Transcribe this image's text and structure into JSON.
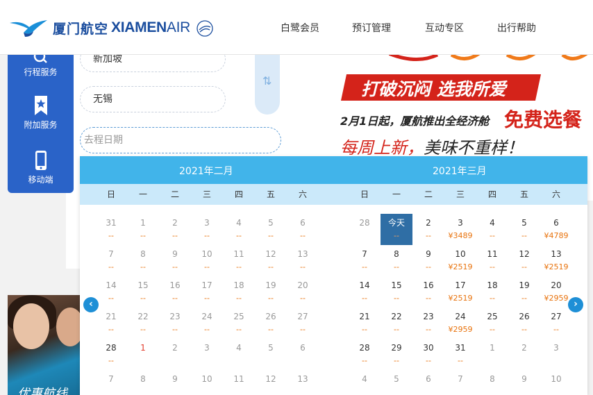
{
  "header": {
    "logo_zh": "厦门航空",
    "logo_en_bold": "XIAMEN",
    "logo_en_thin": "AIR",
    "nav": [
      {
        "label": "白鹭会员",
        "id": "member"
      },
      {
        "label": "预订管理",
        "id": "booking"
      },
      {
        "label": "互动专区",
        "id": "interactive"
      },
      {
        "label": "出行帮助",
        "id": "help"
      }
    ]
  },
  "sidebar": {
    "items": [
      {
        "label": "行程服务",
        "icon": "search-icon"
      },
      {
        "label": "附加服务",
        "icon": "bookmark-star-icon"
      },
      {
        "label": "移动端",
        "icon": "mobile-phone-icon"
      }
    ]
  },
  "booking": {
    "from_value": "新加坡",
    "to_value": "无锡",
    "date_placeholder": "去程日期"
  },
  "banner": {
    "slogan": "打破沉闷 选我所爱",
    "line2": "2月1日起，厦航推出全经济舱",
    "line2_highlight": "免费选餐",
    "line3_red": "每周上新，",
    "line3_dark": "美味不重样！"
  },
  "photo": {
    "caption": "优惠航线"
  },
  "colors": {
    "brand": "#1a4d9e",
    "calendar_header": "#41b4ea",
    "week_row": "#cbe9fa",
    "today": "#2f6ea5",
    "price": "#e8720c"
  },
  "calendar": {
    "weekdays": [
      "日",
      "一",
      "二",
      "三",
      "四",
      "五",
      "六"
    ],
    "months": [
      {
        "title": "2021年二月",
        "weeks": [
          [
            {
              "n": "31",
              "p": "--",
              "s": "dim"
            },
            {
              "n": "1",
              "p": "--",
              "s": "dim"
            },
            {
              "n": "2",
              "p": "--",
              "s": "dim"
            },
            {
              "n": "3",
              "p": "--",
              "s": "dim"
            },
            {
              "n": "4",
              "p": "--",
              "s": "dim"
            },
            {
              "n": "5",
              "p": "--",
              "s": "dim"
            },
            {
              "n": "6",
              "p": "--",
              "s": "dim"
            }
          ],
          [
            {
              "n": "7",
              "p": "--",
              "s": "dim"
            },
            {
              "n": "8",
              "p": "--",
              "s": "dim"
            },
            {
              "n": "9",
              "p": "--",
              "s": "dim"
            },
            {
              "n": "10",
              "p": "--",
              "s": "dim"
            },
            {
              "n": "11",
              "p": "--",
              "s": "dim"
            },
            {
              "n": "12",
              "p": "--",
              "s": "dim"
            },
            {
              "n": "13",
              "p": "--",
              "s": "dim"
            }
          ],
          [
            {
              "n": "14",
              "p": "--",
              "s": "dim"
            },
            {
              "n": "15",
              "p": "--",
              "s": "dim"
            },
            {
              "n": "16",
              "p": "--",
              "s": "dim"
            },
            {
              "n": "17",
              "p": "--",
              "s": "dim"
            },
            {
              "n": "18",
              "p": "--",
              "s": "dim"
            },
            {
              "n": "19",
              "p": "--",
              "s": "dim"
            },
            {
              "n": "20",
              "p": "--",
              "s": "dim"
            }
          ],
          [
            {
              "n": "21",
              "p": "--",
              "s": "dim"
            },
            {
              "n": "22",
              "p": "--",
              "s": "dim"
            },
            {
              "n": "23",
              "p": "--",
              "s": "dim"
            },
            {
              "n": "24",
              "p": "--",
              "s": "dim"
            },
            {
              "n": "25",
              "p": "--",
              "s": "dim"
            },
            {
              "n": "26",
              "p": "--",
              "s": "dim"
            },
            {
              "n": "27",
              "p": "--",
              "s": "dim"
            }
          ],
          [
            {
              "n": "28",
              "p": "--",
              "s": "act"
            },
            {
              "n": "1",
              "p": "",
              "s": "red"
            },
            {
              "n": "2",
              "p": "",
              "s": "dim"
            },
            {
              "n": "3",
              "p": "",
              "s": "dim"
            },
            {
              "n": "4",
              "p": "",
              "s": "dim"
            },
            {
              "n": "5",
              "p": "",
              "s": "dim"
            },
            {
              "n": "6",
              "p": "",
              "s": "dim"
            }
          ],
          [
            {
              "n": "7",
              "p": "",
              "s": "dim"
            },
            {
              "n": "8",
              "p": "",
              "s": "dim"
            },
            {
              "n": "9",
              "p": "",
              "s": "dim"
            },
            {
              "n": "10",
              "p": "",
              "s": "dim"
            },
            {
              "n": "11",
              "p": "",
              "s": "dim"
            },
            {
              "n": "12",
              "p": "",
              "s": "dim"
            },
            {
              "n": "13",
              "p": "",
              "s": "dim"
            }
          ]
        ]
      },
      {
        "title": "2021年三月",
        "weeks": [
          [
            {
              "n": "28",
              "p": "",
              "s": "dim"
            },
            {
              "n": "今天",
              "p": "--",
              "s": "today"
            },
            {
              "n": "2",
              "p": "--",
              "s": "act"
            },
            {
              "n": "3",
              "p": "¥3489",
              "s": "act"
            },
            {
              "n": "4",
              "p": "--",
              "s": "act"
            },
            {
              "n": "5",
              "p": "--",
              "s": "act"
            },
            {
              "n": "6",
              "p": "¥4789",
              "s": "act"
            }
          ],
          [
            {
              "n": "7",
              "p": "--",
              "s": "act"
            },
            {
              "n": "8",
              "p": "--",
              "s": "act"
            },
            {
              "n": "9",
              "p": "--",
              "s": "act"
            },
            {
              "n": "10",
              "p": "¥2519",
              "s": "act"
            },
            {
              "n": "11",
              "p": "--",
              "s": "act"
            },
            {
              "n": "12",
              "p": "--",
              "s": "act"
            },
            {
              "n": "13",
              "p": "¥2519",
              "s": "act"
            }
          ],
          [
            {
              "n": "14",
              "p": "--",
              "s": "act"
            },
            {
              "n": "15",
              "p": "--",
              "s": "act"
            },
            {
              "n": "16",
              "p": "--",
              "s": "act"
            },
            {
              "n": "17",
              "p": "¥2519",
              "s": "act"
            },
            {
              "n": "18",
              "p": "--",
              "s": "act"
            },
            {
              "n": "19",
              "p": "--",
              "s": "act"
            },
            {
              "n": "20",
              "p": "¥2959",
              "s": "act"
            }
          ],
          [
            {
              "n": "21",
              "p": "--",
              "s": "act"
            },
            {
              "n": "22",
              "p": "--",
              "s": "act"
            },
            {
              "n": "23",
              "p": "--",
              "s": "act"
            },
            {
              "n": "24",
              "p": "¥2959",
              "s": "act"
            },
            {
              "n": "25",
              "p": "--",
              "s": "act"
            },
            {
              "n": "26",
              "p": "--",
              "s": "act"
            },
            {
              "n": "27",
              "p": "--",
              "s": "act"
            }
          ],
          [
            {
              "n": "28",
              "p": "--",
              "s": "act"
            },
            {
              "n": "29",
              "p": "--",
              "s": "act"
            },
            {
              "n": "30",
              "p": "--",
              "s": "act"
            },
            {
              "n": "31",
              "p": "--",
              "s": "act"
            },
            {
              "n": "1",
              "p": "",
              "s": "dim"
            },
            {
              "n": "2",
              "p": "",
              "s": "dim"
            },
            {
              "n": "3",
              "p": "",
              "s": "dim"
            }
          ],
          [
            {
              "n": "4",
              "p": "",
              "s": "dim"
            },
            {
              "n": "5",
              "p": "",
              "s": "dim"
            },
            {
              "n": "6",
              "p": "",
              "s": "dim"
            },
            {
              "n": "7",
              "p": "",
              "s": "dim"
            },
            {
              "n": "8",
              "p": "",
              "s": "dim"
            },
            {
              "n": "9",
              "p": "",
              "s": "dim"
            },
            {
              "n": "10",
              "p": "",
              "s": "dim"
            }
          ]
        ]
      }
    ]
  }
}
